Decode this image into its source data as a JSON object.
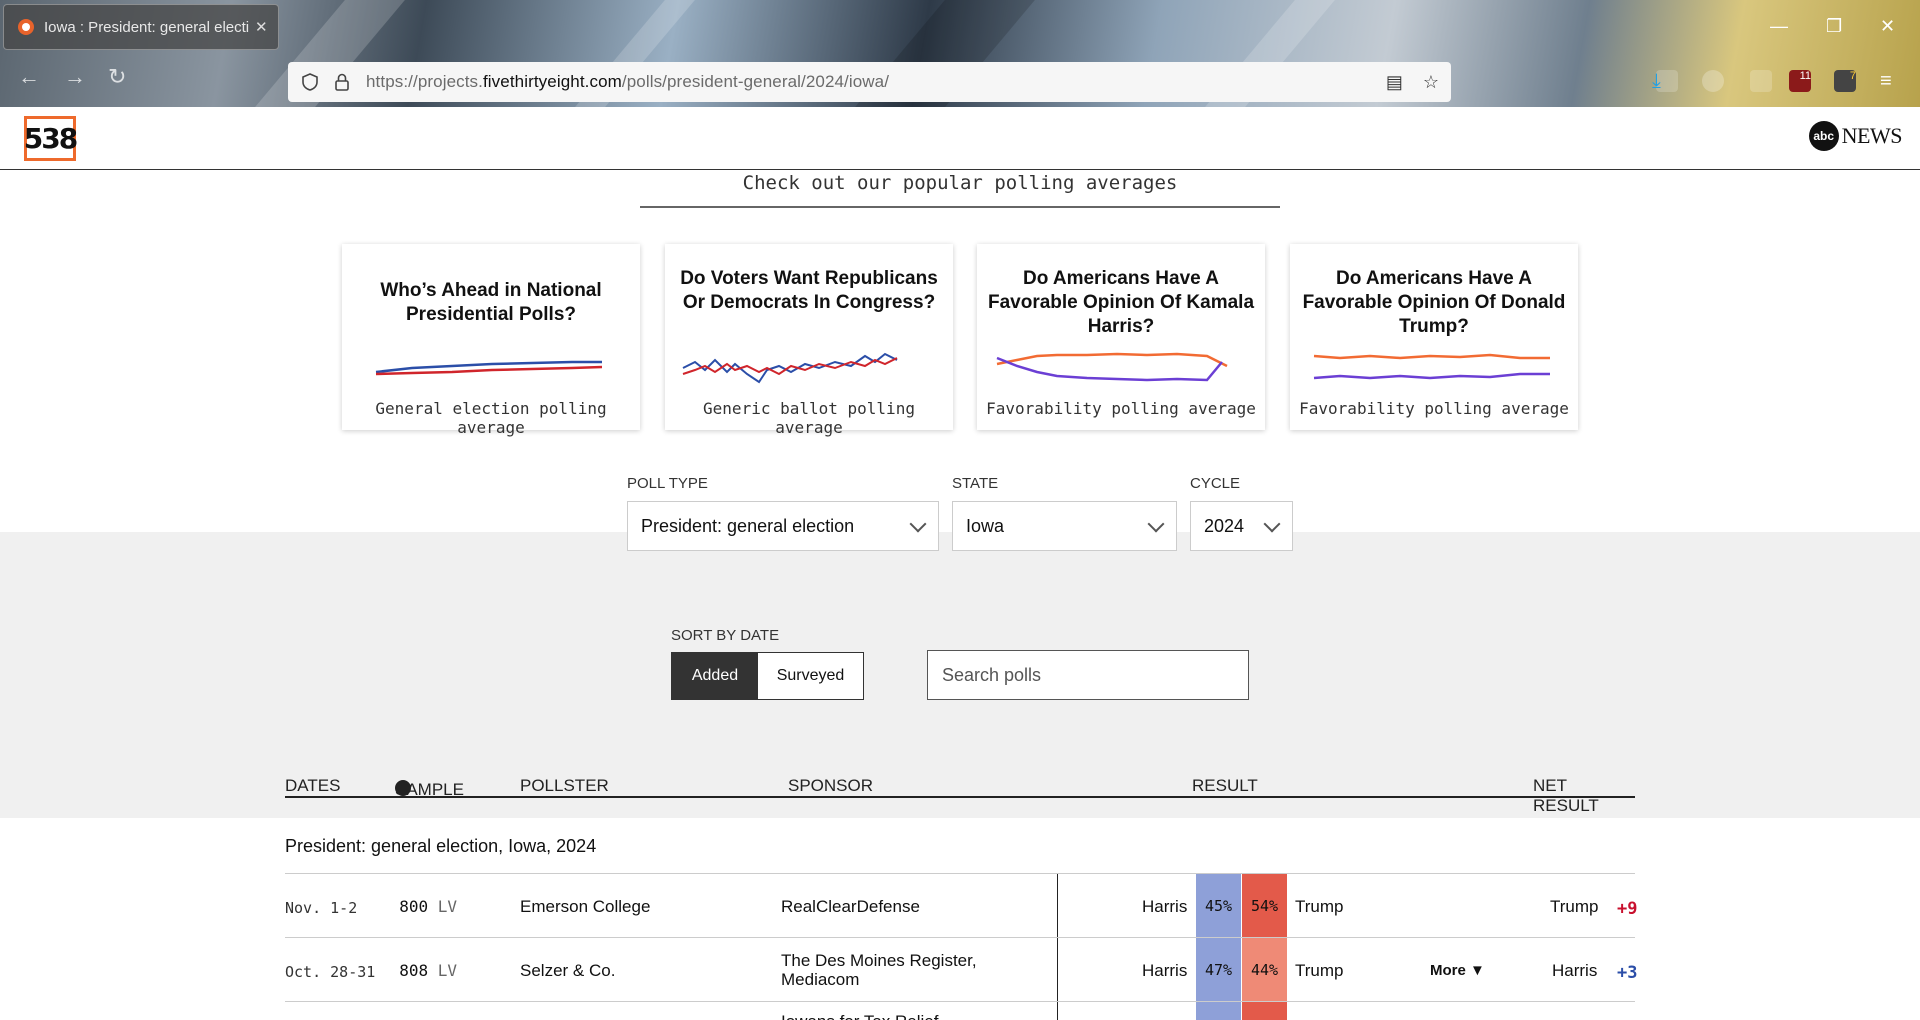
{
  "browser": {
    "tab_title": "Iowa : President: general electi",
    "url_prefix": "https://projects.",
    "url_domain": "fivethirtyeight.com",
    "url_path": "/polls/president-general/2024/iowa/",
    "ext_badge_1": "11",
    "ext_badge_2": "7"
  },
  "site": {
    "logo": "538",
    "partner_ball": "abc",
    "partner_name": "NEWS"
  },
  "promo": {
    "title": "Check out our popular polling averages",
    "cards": [
      {
        "heading": "Who’s Ahead in National Presidential Polls?",
        "subtitle": "General election polling average",
        "colors": [
          "#2b4ea8",
          "#d0252b"
        ]
      },
      {
        "heading": "Do Voters Want Republicans Or Democrats In Congress?",
        "subtitle": "Generic ballot polling average",
        "colors": [
          "#2b4ea8",
          "#d0252b"
        ]
      },
      {
        "heading": "Do Americans Have A Favorable Opinion Of Kamala Harris?",
        "subtitle": "Favorability polling average",
        "colors": [
          "#f26b33",
          "#6b3fd4"
        ]
      },
      {
        "heading": "Do Americans Have A Favorable Opinion Of Donald Trump?",
        "subtitle": "Favorability polling average",
        "colors": [
          "#f26b33",
          "#6b3fd4"
        ]
      }
    ]
  },
  "filters": {
    "poll_type_label": "POLL TYPE",
    "poll_type_value": "President: general election",
    "state_label": "STATE",
    "state_value": "Iowa",
    "cycle_label": "CYCLE",
    "cycle_value": "2024",
    "sort_label": "SORT BY DATE",
    "sort_added": "Added",
    "sort_surveyed": "Surveyed",
    "search_placeholder": "Search polls"
  },
  "table": {
    "headers": {
      "dates": "DATES",
      "sample": "SAMPLE",
      "pollster": "POLLSTER",
      "sponsor": "SPONSOR",
      "result": "RESULT",
      "net": "NET RESULT"
    },
    "info_glyph": "i",
    "group_title": "President: general election, Iowa, 2024",
    "rows": [
      {
        "dates": "Nov. 1-2",
        "sample": "800",
        "pop": "LV",
        "pollster": "Emerson College",
        "sponsor": "RealClearDefense",
        "dem": "Harris",
        "dem_pct": "45%",
        "rep_pct": "54%",
        "rep": "Trump",
        "more": "",
        "net_name": "Trump",
        "net_value": "+9",
        "net_color": "#c8102e"
      },
      {
        "dates": "Oct. 28-31",
        "sample": "808",
        "pop": "LV",
        "pollster": "Selzer & Co.",
        "sponsor": "The Des Moines Register, Mediacom",
        "dem": "Harris",
        "dem_pct": "47%",
        "rep_pct": "44%",
        "rep": "Trump",
        "more": "More ▼",
        "net_name": "Harris",
        "net_value": "+3",
        "net_color": "#2b4ea8"
      }
    ],
    "partial_sponsor": "Iowans for Tax Relief"
  }
}
